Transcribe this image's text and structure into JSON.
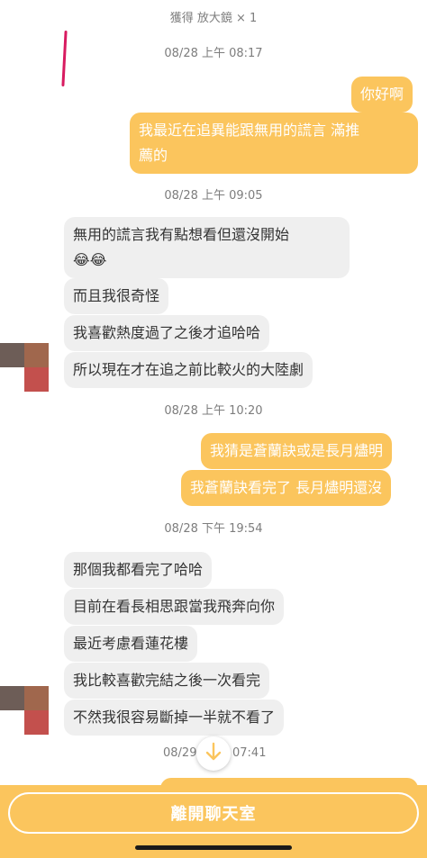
{
  "system_messages": {
    "item_obtained": "獲得 放大鏡 × 1",
    "ts1": "08/28 上午 08:17",
    "ts2": "08/28 上午 09:05",
    "ts3": "08/28 上午 10:20",
    "ts4": "08/28 下午 19:54",
    "ts5_left": "08/29",
    "ts5_right": "07:41"
  },
  "messages": {
    "m1": "你好啊",
    "m2_line1": "我最近在追異能跟無用的謊言 滿推",
    "m2_line2": "薦的",
    "m3_line1": "無用的謊言我有點想看但還沒開始",
    "m3_line2": "😂😂",
    "m4": "而且我很奇怪",
    "m5": "我喜歡熱度過了之後才追哈哈",
    "m6": "所以現在才在追之前比較火的大陸劇",
    "m7": "我猜是蒼蘭訣或是長月燼明",
    "m8": "我蒼蘭訣看完了 長月燼明還沒",
    "m9": "那個我都看完了哈哈",
    "m10": "目前在看長相思跟當我飛奔向你",
    "m11": "最近考慮看蓮花樓",
    "m12": "我比較喜歡完結之後一次看完",
    "m13": "不然我很容易斷掉一半就不看了"
  },
  "footer": {
    "leave_label": "離開聊天室"
  },
  "icons": {
    "scroll_down": "arrow-down-icon"
  },
  "colors": {
    "outgoing_bubble": "#fbc55d",
    "incoming_bubble": "#efefef",
    "annotation_mark": "#d81b60"
  }
}
